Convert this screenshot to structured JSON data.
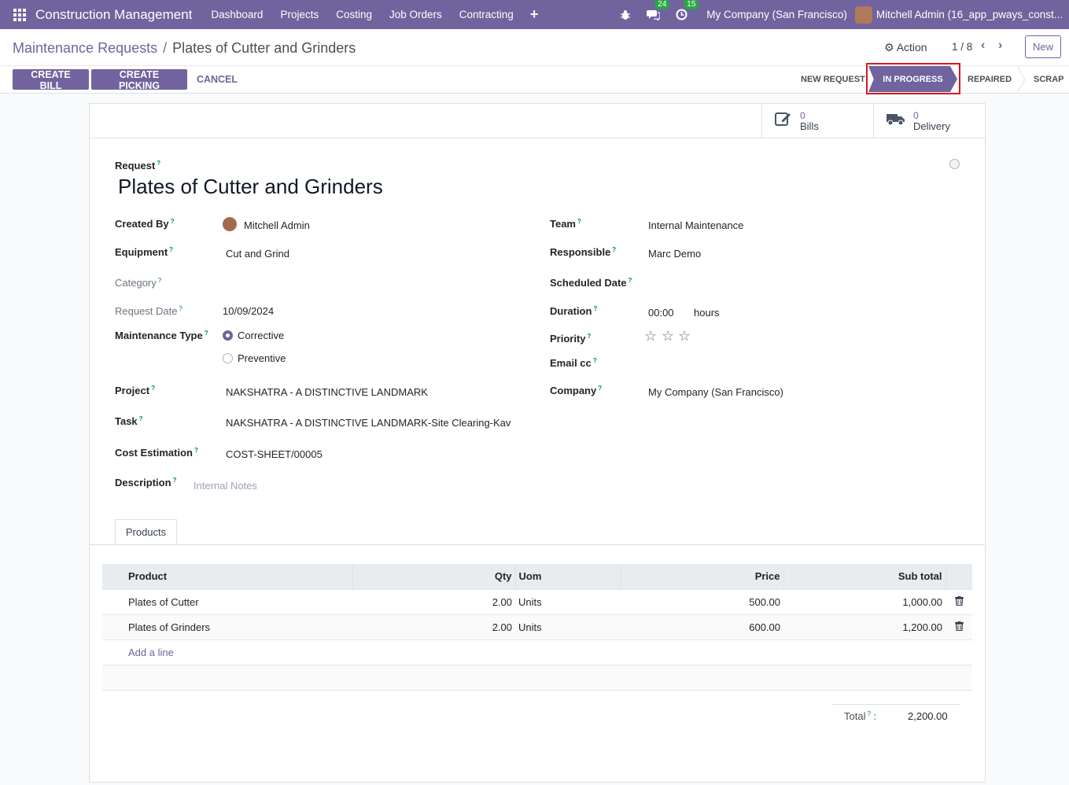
{
  "nav": {
    "brand": "Construction Management",
    "items": [
      "Dashboard",
      "Projects",
      "Costing",
      "Job Orders",
      "Contracting"
    ],
    "messages_count": "24",
    "activities_count": "15",
    "company": "My Company (San Francisco)",
    "user": "Mitchell Admin (16_app_pways_const..."
  },
  "breadcrumb": {
    "parent": "Maintenance Requests",
    "current": "Plates of Cutter and Grinders"
  },
  "control": {
    "action": "Action",
    "pager": "1 / 8",
    "new": "New"
  },
  "buttons": {
    "create_bill": "CREATE BILL",
    "create_picking": "CREATE PICKING",
    "cancel": "CANCEL"
  },
  "stages": {
    "new_request": "NEW REQUEST",
    "in_progress": "IN PROGRESS",
    "repaired": "REPAIRED",
    "scrap": "SCRAP",
    "active": "IN PROGRESS"
  },
  "smart_buttons": {
    "bills": {
      "value": "0",
      "label": "Bills"
    },
    "delivery": {
      "value": "0",
      "label": "Delivery"
    }
  },
  "form": {
    "request_label": "Request",
    "title": "Plates of Cutter and Grinders",
    "created_by_label": "Created By",
    "created_by": "Mitchell Admin",
    "equipment_label": "Equipment",
    "equipment": "Cut and Grind",
    "category_label": "Category",
    "request_date_label": "Request Date",
    "request_date": "10/09/2024",
    "maintenance_type_label": "Maintenance Type",
    "type_corrective": "Corrective",
    "type_preventive": "Preventive",
    "project_label": "Project",
    "project": "NAKSHATRA - A DISTINCTIVE LANDMARK",
    "task_label": "Task",
    "task": "NAKSHATRA - A DISTINCTIVE LANDMARK-Site Clearing-Kav",
    "cost_estimation_label": "Cost Estimation",
    "cost_estimation": "COST-SHEET/00005",
    "description_label": "Description",
    "description_placeholder": "Internal Notes",
    "team_label": "Team",
    "team": "Internal Maintenance",
    "responsible_label": "Responsible",
    "responsible": "Marc Demo",
    "scheduled_date_label": "Scheduled Date",
    "duration_label": "Duration",
    "duration": "00:00",
    "duration_unit": "hours",
    "priority_label": "Priority",
    "email_cc_label": "Email cc",
    "company_label": "Company",
    "company": "My Company (San Francisco)"
  },
  "tabs": {
    "products": "Products"
  },
  "lines": {
    "headers": {
      "product": "Product",
      "qty": "Qty",
      "uom": "Uom",
      "price": "Price",
      "subtotal": "Sub total"
    },
    "rows": [
      {
        "product": "Plates of Cutter",
        "qty": "2.00",
        "uom": "Units",
        "price": "500.00",
        "subtotal": "1,000.00"
      },
      {
        "product": "Plates of Grinders",
        "qty": "2.00",
        "uom": "Units",
        "price": "600.00",
        "subtotal": "1,200.00"
      }
    ],
    "add_line": "Add a line"
  },
  "totals": {
    "label": "Total",
    "suffix": ":",
    "value": "2,200.00"
  }
}
